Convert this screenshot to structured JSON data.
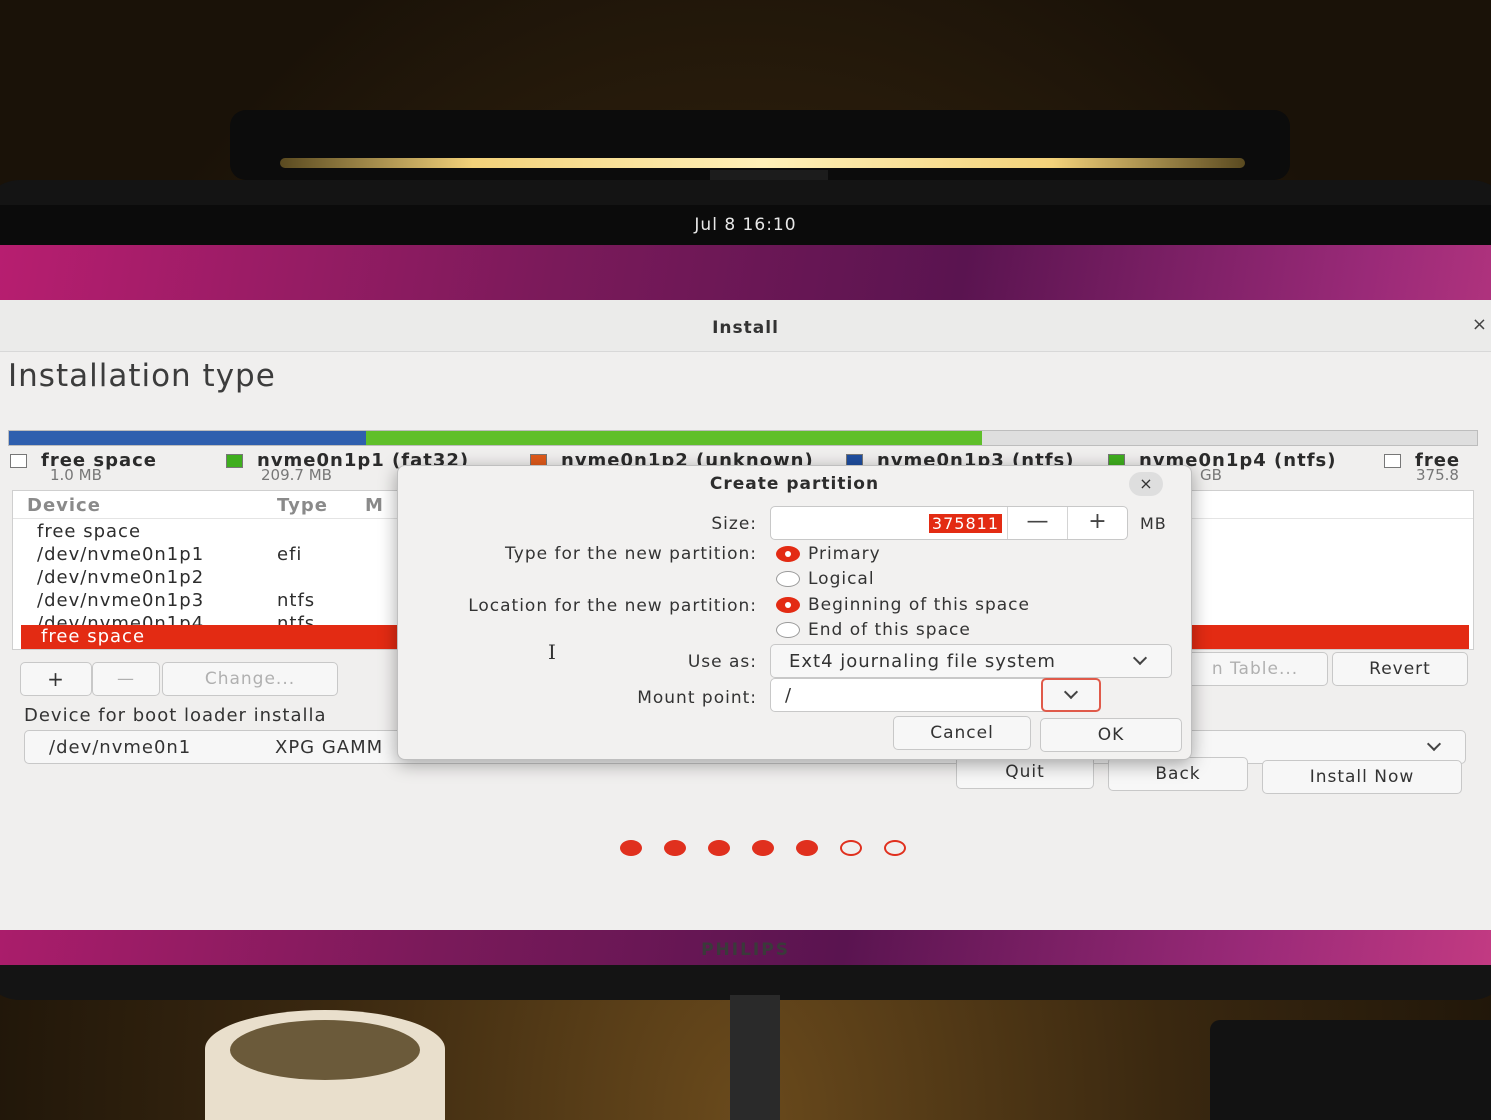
{
  "system": {
    "clock": "Jul 8  16:10",
    "monitor_brand": "PHILIPS"
  },
  "window": {
    "title": "Install",
    "close": "×"
  },
  "page_title": "Installation type",
  "disk_bar": {
    "segments": [
      {
        "color": "#2e5fae",
        "fraction": 0.243
      },
      {
        "color": "#5fbf2a",
        "fraction": 0.42
      },
      {
        "color": "#dedede",
        "fraction": 0.337
      }
    ]
  },
  "legend": [
    {
      "name": "free space",
      "size": "1.0 MB",
      "color": "#ffffff"
    },
    {
      "name": "nvme0n1p1 (fat32)",
      "size": "209.7 MB",
      "color": "#3fae1e"
    },
    {
      "name": "nvme0n1p2 (unknown)",
      "size": "",
      "color": "#e05a1a"
    },
    {
      "name": "nvme0n1p3 (ntfs)",
      "size": "",
      "color": "#1f4ea0"
    },
    {
      "name": "nvme0n1p4 (ntfs)",
      "size": "GB",
      "color": "#3fae1e"
    },
    {
      "name": "free",
      "size": "375.8",
      "color": "#ffffff"
    }
  ],
  "table": {
    "headers": {
      "device": "Device",
      "type": "Type",
      "mount": "M"
    },
    "rows": [
      {
        "device": "free space",
        "type": ""
      },
      {
        "device": "/dev/nvme0n1p1",
        "type": "efi"
      },
      {
        "device": "/dev/nvme0n1p2",
        "type": ""
      },
      {
        "device": "/dev/nvme0n1p3",
        "type": "ntfs"
      },
      {
        "device": "/dev/nvme0n1p4",
        "type": "ntfs"
      },
      {
        "device": "free space",
        "type": ""
      }
    ]
  },
  "table_buttons": {
    "add": "+",
    "remove": "—",
    "change": "Change...",
    "new_table": "n Table...",
    "revert": "Revert"
  },
  "bootloader": {
    "label": "Device for boot loader installa",
    "device": "/dev/nvme0n1",
    "model": "XPG GAMM"
  },
  "nav_buttons": {
    "quit": "Quit",
    "back": "Back",
    "install_now": "Install Now"
  },
  "progress_dots": {
    "total": 7,
    "completed": 5
  },
  "dialog": {
    "title": "Create partition",
    "close": "×",
    "size_label": "Size:",
    "size_value": "375811",
    "minus": "—",
    "plus": "+",
    "unit": "MB",
    "type_label": "Type for the new partition:",
    "type_options": [
      "Primary",
      "Logical"
    ],
    "type_selected": "Primary",
    "location_label": "Location for the new partition:",
    "location_options": [
      "Beginning of this space",
      "End of this space"
    ],
    "location_selected": "Beginning of this space",
    "use_as_label": "Use as:",
    "use_as_value": "Ext4 journaling file system",
    "mount_label": "Mount point:",
    "mount_value": "/",
    "cancel": "Cancel",
    "ok": "OK"
  }
}
